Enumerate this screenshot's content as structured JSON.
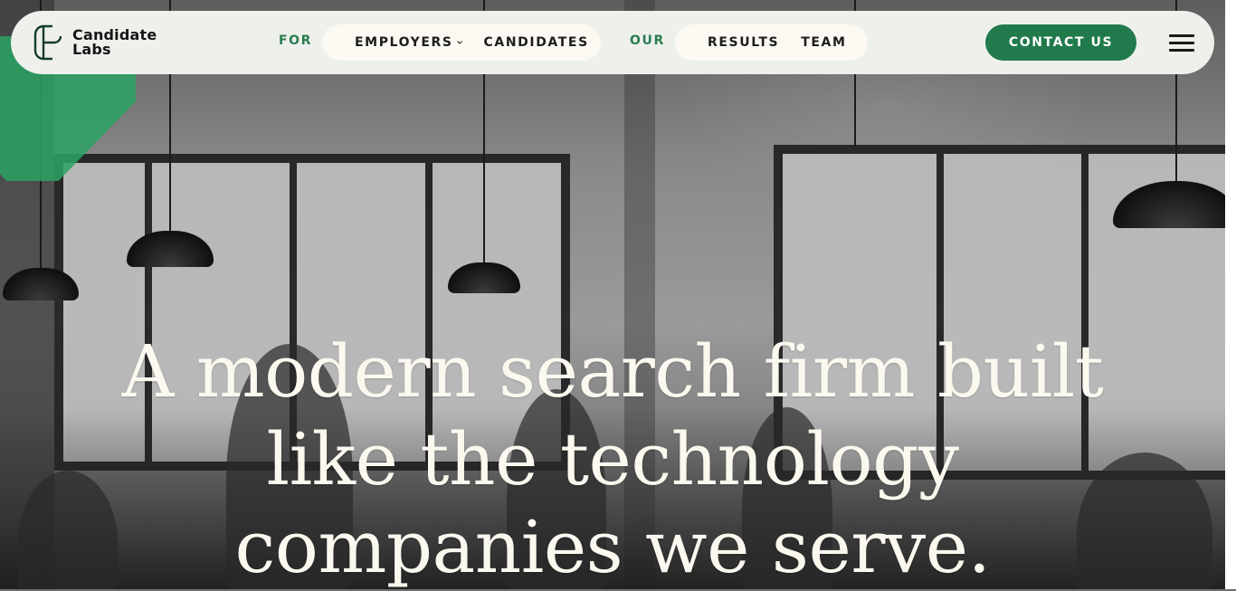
{
  "brand": {
    "name_line1": "Candidate",
    "name_line2": "Labs",
    "logo_icon": "candidate-labs-logo-icon",
    "accent_color": "#217a4c",
    "shape_color": "#2aa363"
  },
  "nav": {
    "for_label": "FOR",
    "employers_label": "EMPLOYERS",
    "candidates_label": "CANDIDATES",
    "our_label": "OUR",
    "results_label": "RESULTS",
    "team_label": "TEAM",
    "contact_label": "CONTACT US",
    "menu_icon": "hamburger-menu-icon",
    "dropdown_icon": "chevron-down-icon"
  },
  "hero": {
    "headline": "A modern search firm built like the technology companies we serve."
  }
}
